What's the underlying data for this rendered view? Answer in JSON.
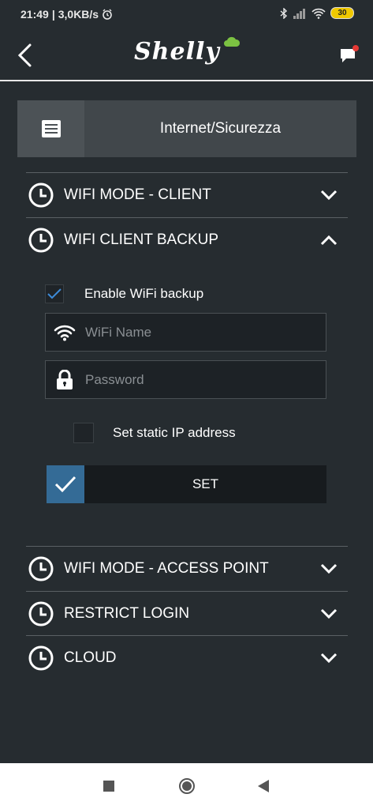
{
  "status": {
    "time": "21:49",
    "speed": "3,0KB/s",
    "battery": "30"
  },
  "header": {
    "logo": "Shelly"
  },
  "section": {
    "title": "Internet/Sicurezza"
  },
  "accordion": {
    "wifi_client": "WIFI MODE - CLIENT",
    "wifi_backup": "WIFI CLIENT BACKUP",
    "access_point": "WIFI MODE - ACCESS POINT",
    "restrict_login": "RESTRICT LOGIN",
    "cloud": "CLOUD"
  },
  "form": {
    "enable_backup_label": "Enable WiFi backup",
    "enable_backup_checked": true,
    "wifi_name_placeholder": "WiFi Name",
    "wifi_name_value": "",
    "password_placeholder": "Password",
    "password_value": "",
    "static_ip_label": "Set static IP address",
    "static_ip_checked": false,
    "set_label": "SET"
  },
  "colors": {
    "background": "#262c30",
    "accent": "#346b96",
    "notification": "#e53935"
  },
  "icons": {
    "back": "chevron-left-icon",
    "chat": "chat-icon",
    "section": "list-icon",
    "row": "clock-icon",
    "wifi": "wifi-icon",
    "lock": "lock-icon"
  }
}
